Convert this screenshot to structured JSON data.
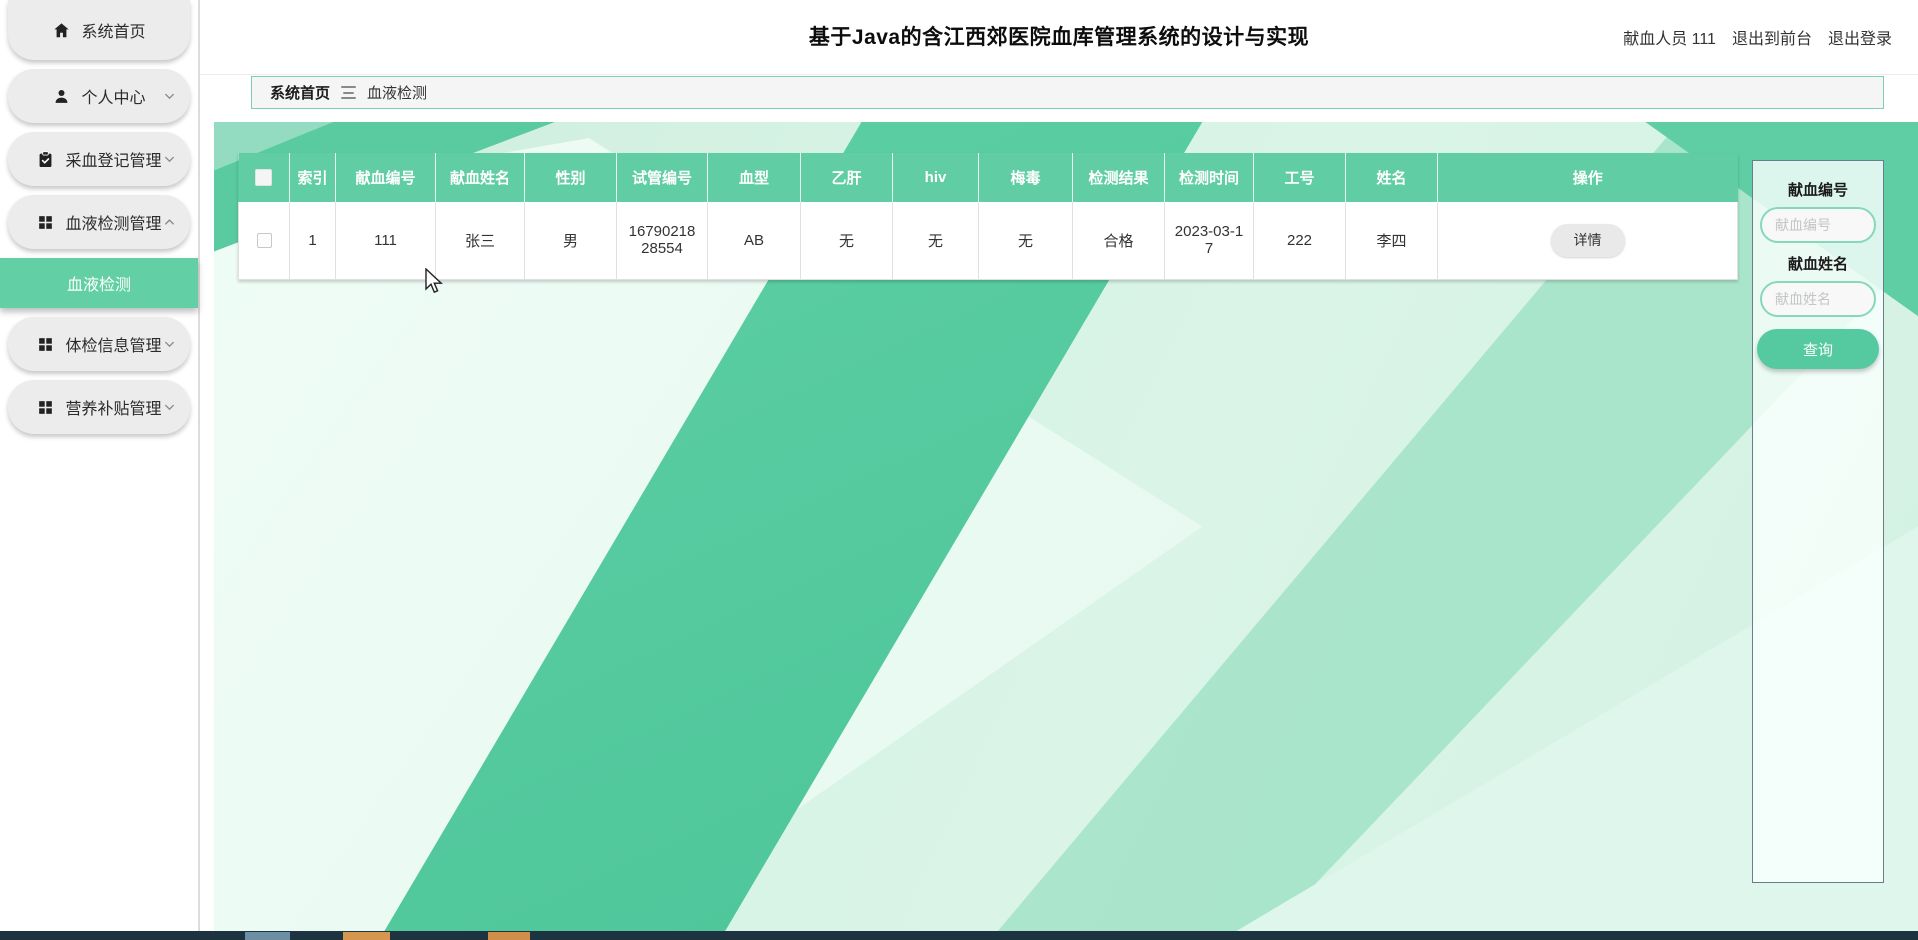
{
  "header": {
    "title": "基于Java的含江西郊医院血库管理系统的设计与实现",
    "user": "献血人员 111",
    "exit_front": "退出到前台",
    "logout": "退出登录"
  },
  "sidebar": {
    "items": [
      {
        "label": "系统首页",
        "icon": "home"
      },
      {
        "label": "个人中心",
        "icon": "user",
        "chevron": "down"
      },
      {
        "label": "采血登记管理",
        "icon": "clipboard-check",
        "chevron": "down"
      },
      {
        "label": "血液检测管理",
        "icon": "grid",
        "chevron": "up"
      },
      {
        "label": "体检信息管理",
        "icon": "grid",
        "chevron": "down"
      },
      {
        "label": "营养补贴管理",
        "icon": "grid",
        "chevron": "down"
      }
    ],
    "active_submenu": "血液检测"
  },
  "breadcrumb": {
    "root": "系统首页",
    "current": "血液检测"
  },
  "table": {
    "headers": [
      "索引",
      "献血编号",
      "献血姓名",
      "性别",
      "试管编号",
      "血型",
      "乙肝",
      "hiv",
      "梅毒",
      "检测结果",
      "检测时间",
      "工号",
      "姓名",
      "操作"
    ],
    "row": {
      "index": "1",
      "donation_no": "111",
      "donor_name": "张三",
      "gender": "男",
      "tube_no": "1679021828554",
      "blood_type": "AB",
      "hepatitis_b": "无",
      "hiv": "无",
      "syphilis": "无",
      "result": "合格",
      "test_time": "2023-03-17",
      "staff_no": "222",
      "staff_name": "李四",
      "detail_label": "详情"
    }
  },
  "search_panel": {
    "donation_no_label": "献血编号",
    "donation_no_placeholder": "献血编号",
    "donor_name_label": "献血姓名",
    "donor_name_placeholder": "献血姓名",
    "query_label": "查询"
  },
  "colors": {
    "accent_green": "#5ecda4",
    "content_mint": "#d7f3e6",
    "sidebar_item_gray": "#ececec"
  }
}
